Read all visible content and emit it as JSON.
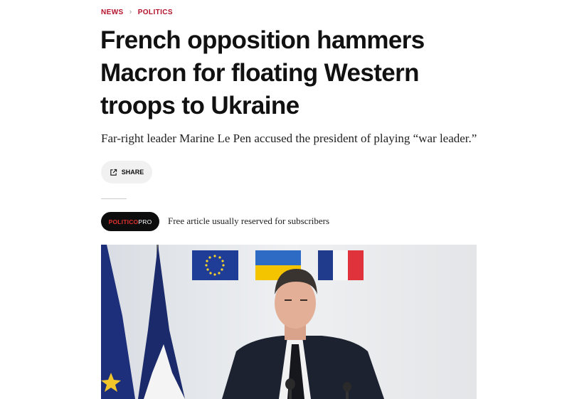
{
  "breadcrumb": {
    "items": [
      "NEWS",
      "POLITICS"
    ],
    "separator": "›"
  },
  "article": {
    "headline": "French opposition hammers Macron for floating Western troops to Ukraine",
    "dek": "Far-right leader Marine Le Pen accused the president of playing “war leader.”",
    "share_label": "SHARE"
  },
  "pro_badge": {
    "part1": "POLITICO",
    "part2": "PRO",
    "note": "Free article usually reserved for subscribers"
  },
  "hero_image": {
    "subject": "man in dark suit in front of flags",
    "flags": [
      "eu-flag",
      "ukraine-flag",
      "france-flag"
    ]
  },
  "colors": {
    "accent": "#b3122b",
    "badge_bg": "#0d0d0d",
    "badge_red": "#e1322f",
    "share_bg": "#f1f1f1"
  }
}
